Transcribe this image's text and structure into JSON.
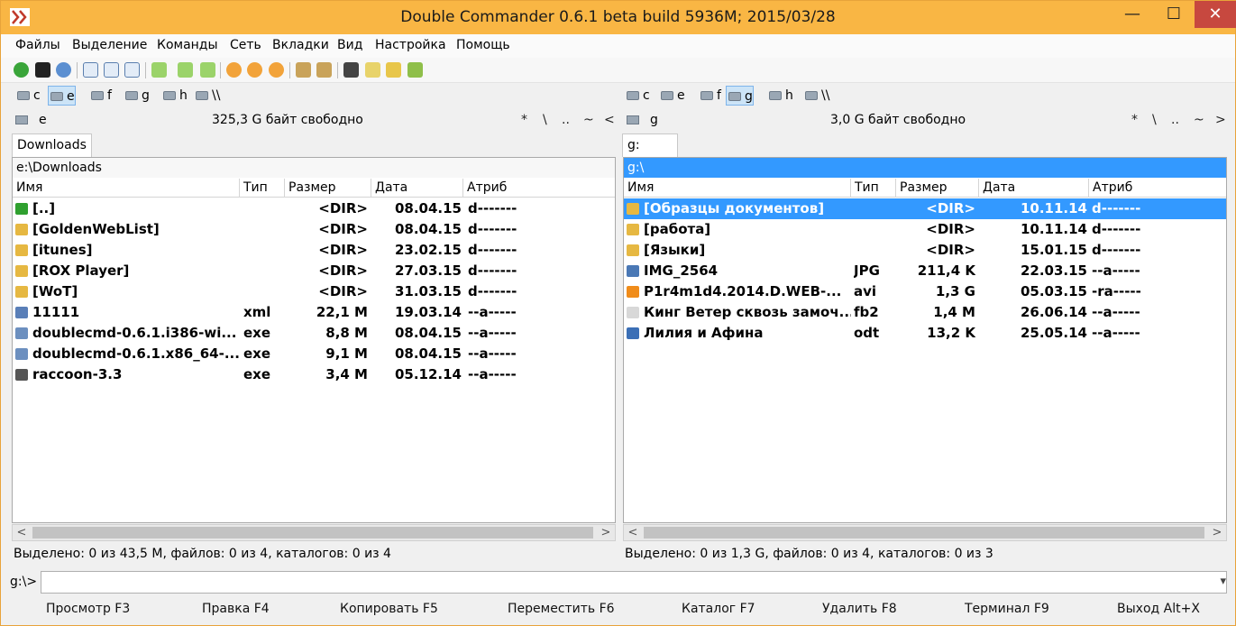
{
  "window": {
    "title": "Double Commander 0.6.1 beta build 5936M; 2015/03/28",
    "minimize": "—",
    "maximize": "☐",
    "close": "✕"
  },
  "menu": [
    "Файлы",
    "Выделение",
    "Команды",
    "Сеть",
    "Вкладки",
    "Вид",
    "Настройка",
    "Помощь"
  ],
  "toolbar_icons": [
    "refresh-icon",
    "terminal-icon",
    "settings-icon",
    "brief-view-icon",
    "full-view-icon",
    "thumbnail-view-icon",
    "copy-names-icon",
    "copy-paths-icon",
    "pack-icon",
    "unpack-icon",
    "test-archive-icon",
    "sync-dirs-icon",
    "compare-icon",
    "search-icon",
    "multi-rename-icon",
    "edit-icon",
    "properties-icon"
  ],
  "left": {
    "drives": [
      "c",
      "e",
      "f",
      "g",
      "h",
      "\\\\"
    ],
    "active_drive": 1,
    "current_drive": "e",
    "free_space": "325,3 G байт свободно",
    "nav": [
      "*",
      "\\",
      "..",
      "~",
      "<"
    ],
    "tab": "Downloads",
    "path": "e:\\Downloads",
    "columns": [
      "Имя",
      "Тип",
      "Размер",
      "Дата",
      "Атриб"
    ],
    "rows": [
      {
        "name": "[..]",
        "ext": "",
        "size": "<DIR>",
        "date": "08.04.15",
        "attr": "d-------",
        "icon": "up-icon",
        "color": "#2fa02f"
      },
      {
        "name": "[GoldenWebList]",
        "ext": "",
        "size": "<DIR>",
        "date": "08.04.15",
        "attr": "d-------",
        "icon": "folder-icon",
        "color": "#e6b842"
      },
      {
        "name": "[itunes]",
        "ext": "",
        "size": "<DIR>",
        "date": "23.02.15",
        "attr": "d-------",
        "icon": "folder-icon",
        "color": "#e6b842"
      },
      {
        "name": "[ROX Player]",
        "ext": "",
        "size": "<DIR>",
        "date": "27.03.15",
        "attr": "d-------",
        "icon": "folder-icon",
        "color": "#e6b842"
      },
      {
        "name": "[WoT]",
        "ext": "",
        "size": "<DIR>",
        "date": "31.03.15",
        "attr": "d-------",
        "icon": "folder-icon",
        "color": "#e6b842"
      },
      {
        "name": "11111",
        "ext": "xml",
        "size": "22,1 M",
        "date": "19.03.14",
        "attr": "--a-----",
        "icon": "xml-file-icon",
        "color": "#5a7fb8"
      },
      {
        "name": "doublecmd-0.6.1.i386-wi...",
        "ext": "exe",
        "size": "8,8 M",
        "date": "08.04.15",
        "attr": "--a-----",
        "icon": "installer-icon",
        "color": "#6c8fbf"
      },
      {
        "name": "doublecmd-0.6.1.x86_64-...",
        "ext": "exe",
        "size": "9,1 M",
        "date": "08.04.15",
        "attr": "--a-----",
        "icon": "installer-icon",
        "color": "#6c8fbf"
      },
      {
        "name": "raccoon-3.3",
        "ext": "exe",
        "size": "3,4 M",
        "date": "05.12.14",
        "attr": "--a-----",
        "icon": "raccoon-icon",
        "color": "#555555"
      }
    ],
    "status": "Выделено: 0 из 43,5 M, файлов: 0 из 4, каталогов: 0 из 4"
  },
  "right": {
    "drives": [
      "c",
      "e",
      "f",
      "g",
      "h",
      "\\\\"
    ],
    "active_drive": 3,
    "current_drive": "g",
    "free_space": "3,0 G байт свободно",
    "nav": [
      "*",
      "\\",
      "..",
      "~",
      ">"
    ],
    "tab": "g:",
    "path": "g:\\",
    "columns": [
      "Имя",
      "Тип",
      "Размер",
      "Дата",
      "Атриб"
    ],
    "rows": [
      {
        "name": "[Образцы документов]",
        "ext": "",
        "size": "<DIR>",
        "date": "10.11.14",
        "attr": "d-------",
        "icon": "folder-icon",
        "color": "#e6b842",
        "selected": true
      },
      {
        "name": "[работа]",
        "ext": "",
        "size": "<DIR>",
        "date": "10.11.14",
        "attr": "d-------",
        "icon": "folder-icon",
        "color": "#e6b842"
      },
      {
        "name": "[Языки]",
        "ext": "",
        "size": "<DIR>",
        "date": "15.01.15",
        "attr": "d-------",
        "icon": "folder-icon",
        "color": "#e6b842"
      },
      {
        "name": "IMG_2564",
        "ext": "JPG",
        "size": "211,4 K",
        "date": "22.03.15",
        "attr": "--a-----",
        "icon": "image-file-icon",
        "color": "#4a78b5"
      },
      {
        "name": "P1r4m1d4.2014.D.WEB-...",
        "ext": "avi",
        "size": "1,3 G",
        "date": "05.03.15",
        "attr": "-ra-----",
        "icon": "vlc-icon",
        "color": "#f08c1a"
      },
      {
        "name": "Кинг Ветер сквозь замоч...",
        "ext": "fb2",
        "size": "1,4 M",
        "date": "26.06.14",
        "attr": "--a-----",
        "icon": "document-icon",
        "color": "#d8d8d8"
      },
      {
        "name": "Лилия и Афина",
        "ext": "odt",
        "size": "13,2 K",
        "date": "25.05.14",
        "attr": "--a-----",
        "icon": "writer-doc-icon",
        "color": "#3b6fb6"
      }
    ],
    "status": "Выделено: 0 из 1,3 G, файлов: 0 из 4, каталогов: 0 из 3"
  },
  "cmdline": {
    "prompt": "g:\\>",
    "value": ""
  },
  "fkeys": [
    "Просмотр F3",
    "Правка F4",
    "Копировать F5",
    "Переместить F6",
    "Каталог F7",
    "Удалить F8",
    "Терминал F9",
    "Выход Alt+X"
  ]
}
